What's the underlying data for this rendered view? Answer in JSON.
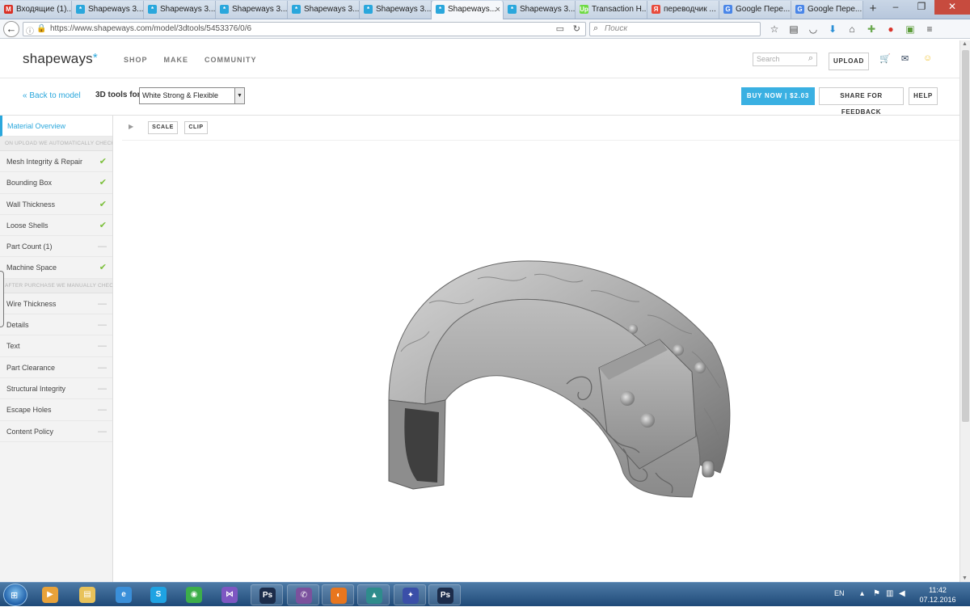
{
  "browser": {
    "tabs": [
      {
        "label": "Входящие (1)...",
        "icon": "gmail-icon",
        "color": "#d93025",
        "glyph": "M"
      },
      {
        "label": "Shapeways 3...",
        "icon": "shapeways-icon",
        "color": "#2aa7dc",
        "glyph": "*"
      },
      {
        "label": "Shapeways 3...",
        "icon": "shapeways-icon",
        "color": "#2aa7dc",
        "glyph": "*"
      },
      {
        "label": "Shapeways 3...",
        "icon": "shapeways-icon",
        "color": "#2aa7dc",
        "glyph": "*"
      },
      {
        "label": "Shapeways 3...",
        "icon": "shapeways-icon",
        "color": "#2aa7dc",
        "glyph": "*"
      },
      {
        "label": "Shapeways 3...",
        "icon": "shapeways-icon",
        "color": "#2aa7dc",
        "glyph": "*"
      },
      {
        "label": "Shapeways...",
        "icon": "shapeways-icon",
        "color": "#2aa7dc",
        "glyph": "*",
        "active": true
      },
      {
        "label": "Shapeways 3...",
        "icon": "shapeways-icon",
        "color": "#2aa7dc",
        "glyph": "*"
      },
      {
        "label": "Transaction H...",
        "icon": "upwork-icon",
        "color": "#6fda44",
        "glyph": "Up"
      },
      {
        "label": "переводчик ...",
        "icon": "yandex-icon",
        "color": "#e84a3b",
        "glyph": "Я"
      },
      {
        "label": "Google Пере...",
        "icon": "google-translate-icon",
        "color": "#4a86e8",
        "glyph": "G"
      },
      {
        "label": "Google Пере...",
        "icon": "google-translate-icon",
        "color": "#4a86e8",
        "glyph": "G"
      }
    ],
    "new_tab": "+",
    "url_host": "https://www.shapeways.com",
    "url_path": "/model/3dtools/5453376/0/6",
    "search_placeholder": "Поиск"
  },
  "site": {
    "logo": "shapeways",
    "logo_mark": "*",
    "nav": [
      "SHOP",
      "MAKE",
      "COMMUNITY"
    ],
    "search_placeholder": "Search",
    "upload_label": "UPLOAD"
  },
  "toolbar": {
    "back_label": "« Back to model",
    "tools_for_label": "3D tools for",
    "material_value": "White Strong & Flexible",
    "buy_label": "BUY NOW  |  $2.03",
    "share_label": "SHARE FOR FEEDBACK",
    "help_label": "HELP"
  },
  "sidebar": {
    "overview_label": "Material Overview",
    "auto_heading": "ON UPLOAD WE AUTOMATICALLY CHECK...",
    "auto_items": [
      {
        "label": "Mesh Integrity & Repair",
        "status": "ok"
      },
      {
        "label": "Bounding Box",
        "status": "ok"
      },
      {
        "label": "Wall Thickness",
        "status": "ok"
      },
      {
        "label": "Loose Shells",
        "status": "ok"
      },
      {
        "label": "Part Count (1)",
        "status": "na"
      },
      {
        "label": "Machine Space",
        "status": "ok"
      }
    ],
    "manual_heading": "AFTER PURCHASE WE MANUALLY CHECK...",
    "manual_items": [
      {
        "label": "Wire Thickness",
        "status": "na"
      },
      {
        "label": "Details",
        "status": "na"
      },
      {
        "label": "Text",
        "status": "na"
      },
      {
        "label": "Part Clearance",
        "status": "na"
      },
      {
        "label": "Structural Integrity",
        "status": "na"
      },
      {
        "label": "Escape Holes",
        "status": "na"
      },
      {
        "label": "Content Policy",
        "status": "na"
      }
    ]
  },
  "viewer": {
    "scale_label": "SCALE",
    "clip_label": "CLIP"
  },
  "taskbar": {
    "apps": [
      {
        "name": "media-player-icon",
        "color": "#e8a23a",
        "glyph": "▶"
      },
      {
        "name": "file-explorer-icon",
        "color": "#e8c25a",
        "glyph": "▤"
      },
      {
        "name": "internet-explorer-icon",
        "color": "#3a8fd9",
        "glyph": "e"
      },
      {
        "name": "skype-icon",
        "color": "#1fa3e3",
        "glyph": "S"
      },
      {
        "name": "chrome-icon",
        "color": "#3cae4a",
        "glyph": "◉"
      },
      {
        "name": "visual-studio-icon",
        "color": "#7e57c2",
        "glyph": "⋈"
      },
      {
        "name": "photoshop-icon",
        "color": "#1c2c4a",
        "glyph": "Ps"
      },
      {
        "name": "viber-icon",
        "color": "#7b519d",
        "glyph": "✆"
      },
      {
        "name": "firefox-icon",
        "color": "#e8761e",
        "glyph": "◐"
      },
      {
        "name": "3d-app-icon",
        "color": "#2e8c8c",
        "glyph": "▲"
      },
      {
        "name": "network-app-icon",
        "color": "#3a4fa8",
        "glyph": "✦"
      },
      {
        "name": "photoshop-icon",
        "color": "#1c2c4a",
        "glyph": "Ps"
      }
    ],
    "lang": "EN",
    "time": "11:42",
    "date": "07.12.2016"
  }
}
